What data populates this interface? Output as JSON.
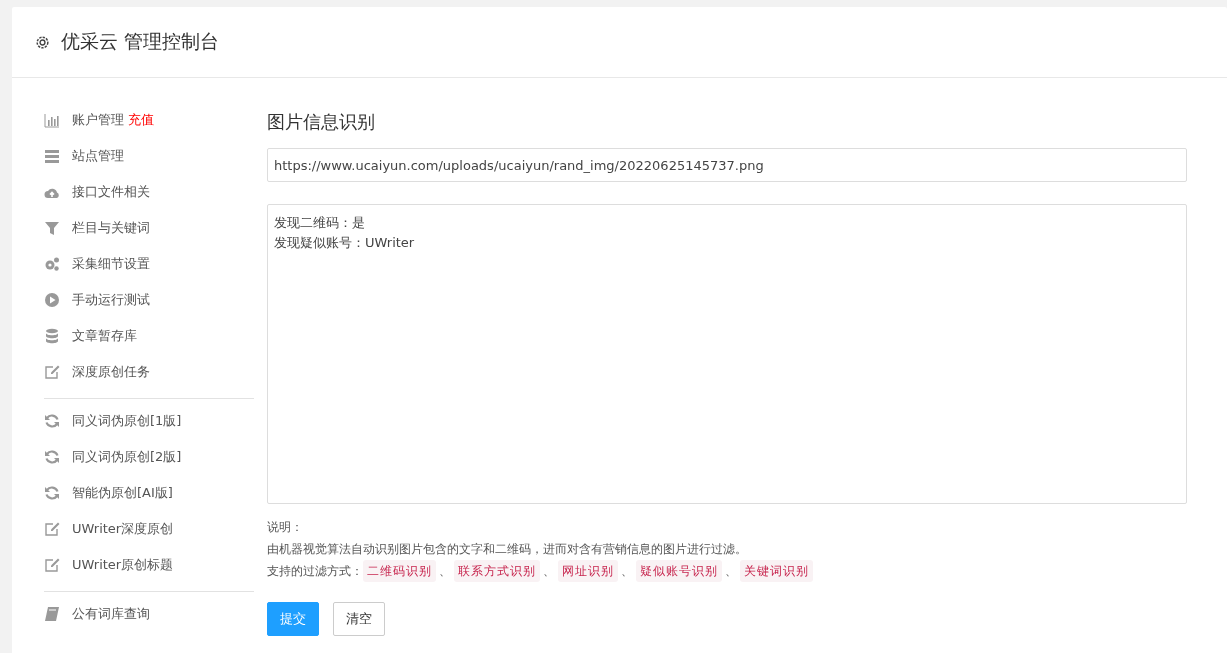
{
  "header": {
    "title": "优采云 管理控制台"
  },
  "sidebar": {
    "groups": [
      {
        "items": [
          {
            "kind": "chart",
            "label": "账户管理",
            "badge": "充值"
          },
          {
            "kind": "server",
            "label": "站点管理"
          },
          {
            "kind": "cloud",
            "label": "接口文件相关"
          },
          {
            "kind": "filter",
            "label": "栏目与关键词"
          },
          {
            "kind": "gears",
            "label": "采集细节设置"
          },
          {
            "kind": "play",
            "label": "手动运行测试"
          },
          {
            "kind": "database",
            "label": "文章暂存库"
          },
          {
            "kind": "edit",
            "label": "深度原创任务"
          }
        ]
      },
      {
        "items": [
          {
            "kind": "refresh",
            "label": "同义词伪原创[1版]"
          },
          {
            "kind": "refresh",
            "label": "同义词伪原创[2版]"
          },
          {
            "kind": "refresh",
            "label": "智能伪原创[AI版]"
          },
          {
            "kind": "edit",
            "label": "UWriter深度原创"
          },
          {
            "kind": "edit",
            "label": "UWriter原创标题"
          }
        ]
      },
      {
        "items": [
          {
            "kind": "book",
            "label": "公有词库查询"
          }
        ]
      }
    ]
  },
  "main": {
    "title": "图片信息识别",
    "url_field": {
      "value": "https://www.ucaiyun.com/uploads/ucaiyun/rand_img/20220625145737.png"
    },
    "result_box": {
      "lines": [
        "发现二维码：是",
        "发现疑似账号：UWriter"
      ]
    },
    "note_heading": "说明：",
    "note_text": "由机器视觉算法自动识别图片包含的文字和二维码，进而对含有营销信息的图片进行过滤。",
    "methods_label": "支持的过滤方式：",
    "methods": [
      "二维码识别",
      "联系方式识别",
      "网址识别",
      "疑似账号识别",
      "关键词识别"
    ],
    "separator": "、",
    "buttons": [
      {
        "kind": "primary",
        "label": "提交"
      },
      {
        "kind": "default",
        "label": "清空"
      }
    ]
  }
}
